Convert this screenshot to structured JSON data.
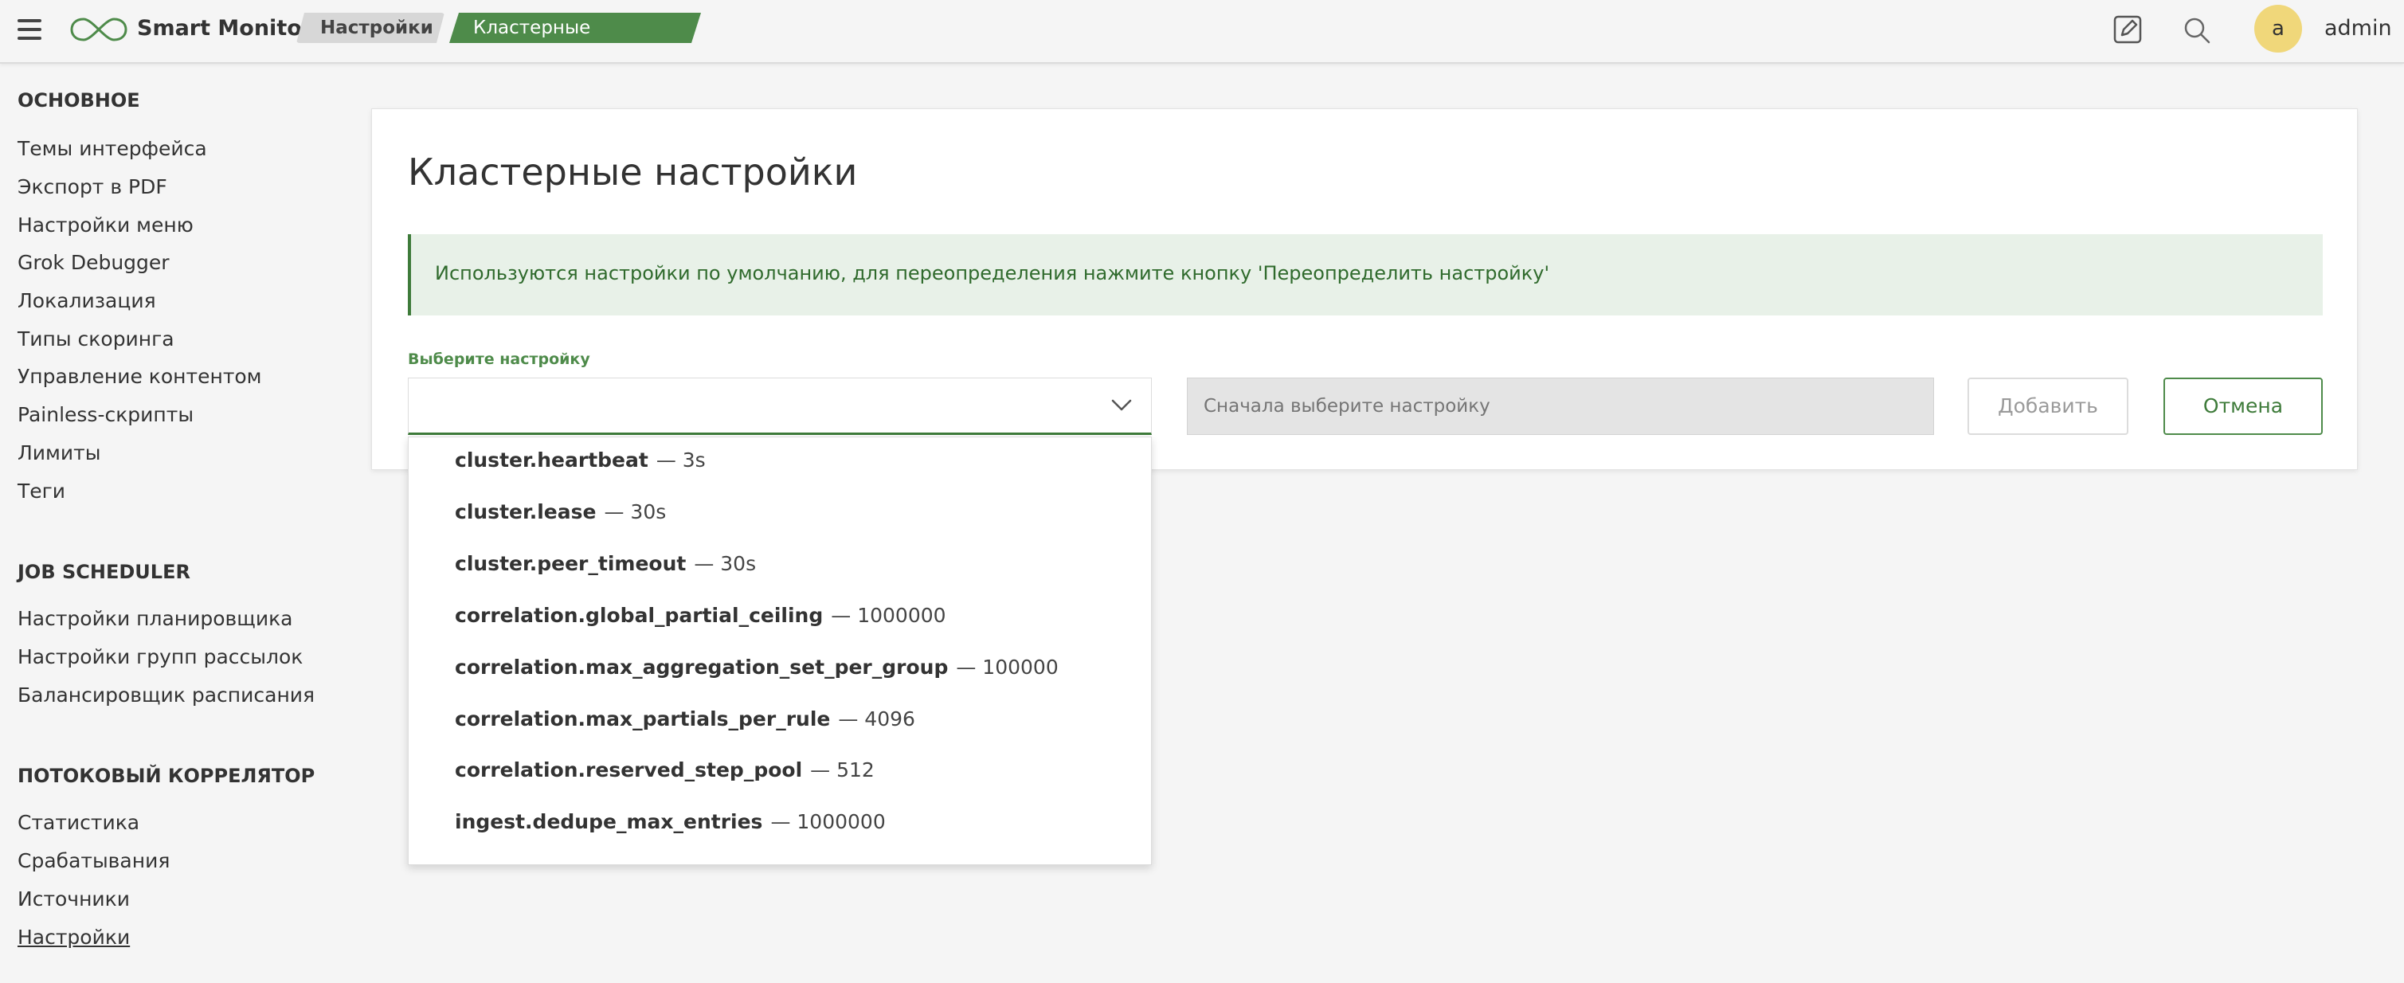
{
  "header": {
    "app_name": "Smart Monitor",
    "breadcrumbs": [
      "Настройки",
      "Кластерные настройки"
    ],
    "avatar_letter": "a",
    "username": "admin"
  },
  "sidebar": {
    "sections": [
      {
        "title": "ОСНОВНОЕ",
        "items": [
          "Темы интерфейса",
          "Экспорт в PDF",
          "Настройки меню",
          "Grok Debugger",
          "Локализация",
          "Типы скоринга",
          "Управление контентом",
          "Painless-скрипты",
          "Лимиты",
          "Теги"
        ]
      },
      {
        "title": "JOB SCHEDULER",
        "items": [
          "Настройки планировщика",
          "Настройки групп рассылок",
          "Балансировщик расписания"
        ]
      },
      {
        "title": "ПОТОКОВЫЙ КОРРЕЛЯТОР",
        "items": [
          "Статистика",
          "Срабатывания",
          "Источники",
          "Настройки"
        ]
      }
    ],
    "active_item": "Настройки"
  },
  "main": {
    "title": "Кластерные настройки",
    "notice": "Используются настройки по умолчанию, для переопределения нажмите кнопку 'Переопределить настройку'",
    "field_label": "Выберите настройку",
    "value_placeholder": "Сначала выберите настройку",
    "add_label": "Добавить",
    "cancel_label": "Отмена"
  },
  "dropdown": {
    "options": [
      {
        "name": "cluster.heartbeat",
        "value": "— 3s"
      },
      {
        "name": "cluster.lease",
        "value": "— 30s"
      },
      {
        "name": "cluster.peer_timeout",
        "value": "— 30s"
      },
      {
        "name": "correlation.global_partial_ceiling",
        "value": "— 1000000"
      },
      {
        "name": "correlation.max_aggregation_set_per_group",
        "value": "— 100000"
      },
      {
        "name": "correlation.max_partials_per_rule",
        "value": "— 4096"
      },
      {
        "name": "correlation.reserved_step_pool",
        "value": "— 512"
      },
      {
        "name": "ingest.dedupe_max_entries",
        "value": "— 1000000"
      }
    ]
  },
  "colors": {
    "accent": "#4e8b4a",
    "notice_bg": "#e8f1e8",
    "avatar_bg": "#f0d77a"
  },
  "icons": [
    "menu-icon",
    "logo-infinity-icon",
    "edit-icon",
    "search-icon",
    "chevron-down-icon"
  ]
}
